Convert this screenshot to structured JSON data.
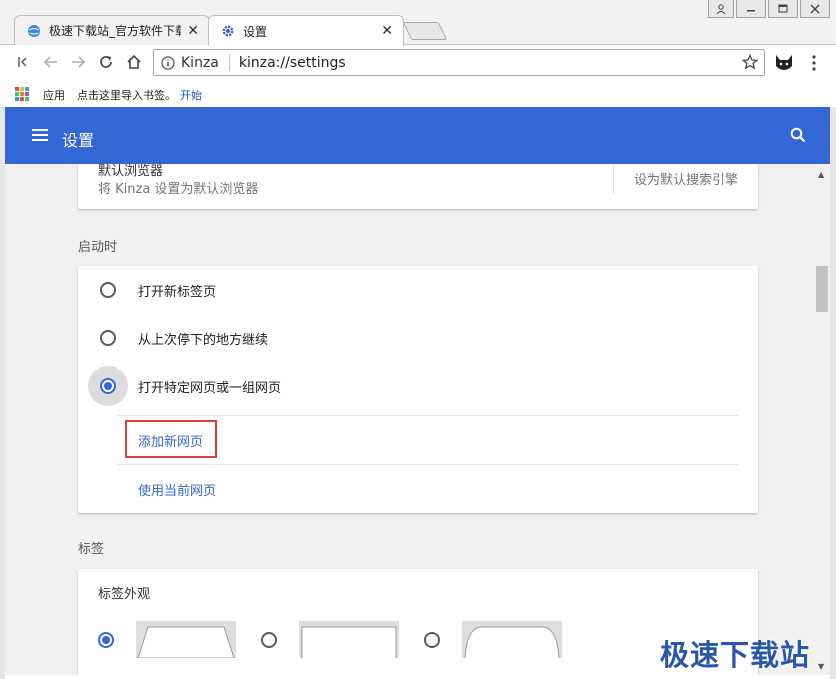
{
  "window": {
    "tabs": [
      {
        "title": "极速下载站_官方软件下载_",
        "close": "✕"
      },
      {
        "title": "设置",
        "close": "✕"
      }
    ]
  },
  "toolbar": {
    "site_label": "Kinza",
    "url": "kinza://settings"
  },
  "bookmarks": {
    "apps_label": "应用",
    "import_prompt": "点击这里导入书签。",
    "start_link": "开始"
  },
  "header": {
    "title": "设置"
  },
  "default_browser": {
    "title": "默认浏览器",
    "description": "将 Kinza 设置为默认浏览器",
    "action": "设为默认搜索引擎"
  },
  "startup": {
    "section_title": "启动时",
    "options": [
      {
        "label": "打开新标签页",
        "checked": false
      },
      {
        "label": "从上次停下的地方继续",
        "checked": false
      },
      {
        "label": "打开特定网页或一组网页",
        "checked": true
      }
    ],
    "add_page_link": "添加新网页",
    "use_current_link": "使用当前网页"
  },
  "tabs_section": {
    "section_title": "标签",
    "appearance_title": "标签外观",
    "selected_style_index": 0
  },
  "watermark": "极速下载站",
  "colors": {
    "accent": "#3367d6",
    "highlight_box": "#e03c3c"
  }
}
